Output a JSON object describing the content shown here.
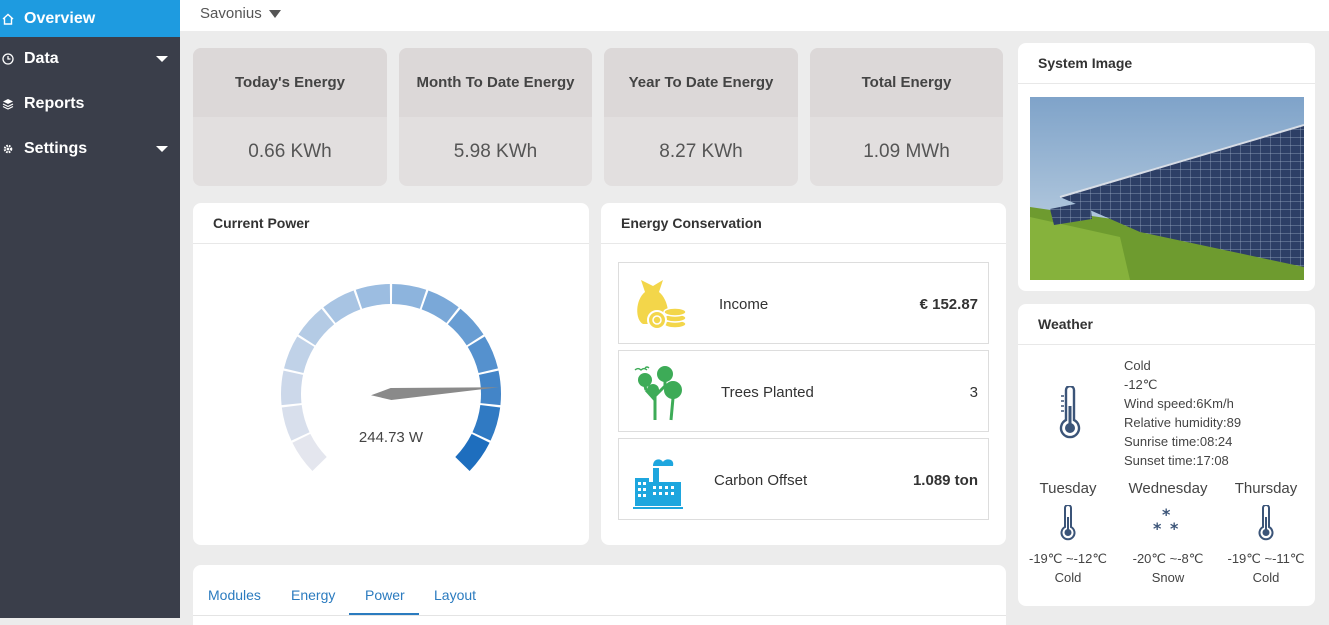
{
  "sidebar": {
    "items": [
      {
        "label": "Overview"
      },
      {
        "label": "Data"
      },
      {
        "label": "Reports"
      },
      {
        "label": "Settings"
      }
    ]
  },
  "topbar": {
    "site": "Savonius"
  },
  "kpis": [
    {
      "title": "Today's Energy",
      "value": "0.66 KWh"
    },
    {
      "title": "Month To Date Energy",
      "value": "5.98 KWh"
    },
    {
      "title": "Year To Date Energy",
      "value": "8.27 KWh"
    },
    {
      "title": "Total Energy",
      "value": "1.09 MWh"
    }
  ],
  "current_power": {
    "title": "Current Power",
    "reading": "244.73 W",
    "gauge_fraction": 0.82
  },
  "conservation": {
    "title": "Energy Conservation",
    "rows": [
      {
        "label": "Income",
        "value": "€ 152.87"
      },
      {
        "label": "Trees Planted",
        "value": "3"
      },
      {
        "label": "Carbon Offset",
        "value": "1.089 ton"
      }
    ]
  },
  "system_image": {
    "title": "System Image"
  },
  "weather": {
    "title": "Weather",
    "now": {
      "condition": "Cold",
      "temp": "-12℃",
      "wind": "Wind speed:6Km/h",
      "humidity": "Relative humidity:89",
      "sunrise": "Sunrise time:08:24",
      "sunset": "Sunset time:17:08"
    },
    "forecast": [
      {
        "day": "Tuesday",
        "range": "-19℃ ~-12℃",
        "cond": "Cold",
        "icon": "thermometer-icon"
      },
      {
        "day": "Wednesday",
        "range": "-20℃ ~-8℃",
        "cond": "Snow",
        "icon": "snow-icon"
      },
      {
        "day": "Thursday",
        "range": "-19℃ ~-11℃",
        "cond": "Cold",
        "icon": "thermometer-icon"
      }
    ]
  },
  "tabs": [
    "Modules",
    "Energy",
    "Power",
    "Layout"
  ],
  "active_tab": "Power",
  "colors": {
    "accent": "#1e9be0",
    "sidebar": "#3a3e4a",
    "tab_text": "#2b7bbf"
  }
}
